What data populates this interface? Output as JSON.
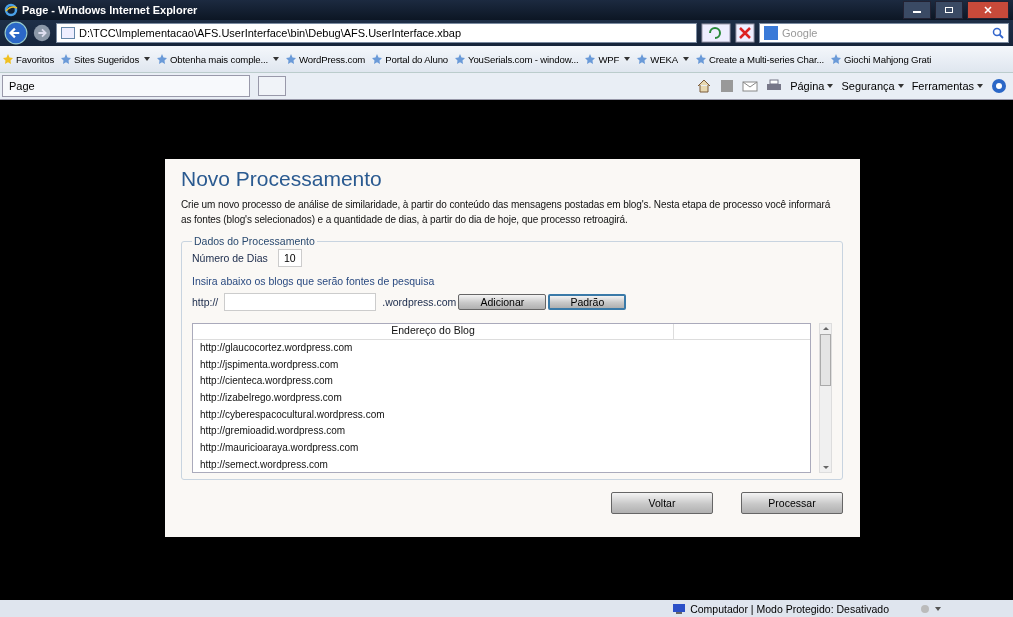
{
  "window": {
    "title": "Page - Windows Internet Explorer"
  },
  "address_bar": {
    "url": "D:\\TCC\\Implementacao\\AFS.UserInterface\\bin\\Debug\\AFS.UserInterface.xbap",
    "search_placeholder": "Google"
  },
  "favorites_bar": [
    {
      "label": "Favoritos",
      "dropdown": false
    },
    {
      "label": "Sites Sugeridos",
      "dropdown": true
    },
    {
      "label": "Obtenha mais comple...",
      "dropdown": true
    },
    {
      "label": "WordPress.com",
      "dropdown": false
    },
    {
      "label": "Portal do Aluno",
      "dropdown": false
    },
    {
      "label": "YouSerials.com - window...",
      "dropdown": false
    },
    {
      "label": "WPF",
      "dropdown": true
    },
    {
      "label": "WEKA",
      "dropdown": true
    },
    {
      "label": "Create a Multi-series Char...",
      "dropdown": false
    },
    {
      "label": "Giochi Mahjong Grati",
      "dropdown": false
    }
  ],
  "tab": {
    "label": "Page"
  },
  "command_bar": [
    "Página",
    "Segurança",
    "Ferramentas"
  ],
  "page": {
    "title": "Novo Processamento",
    "description": "Crie um novo processo de análise de similaridade, à partir do conteúdo das mensagens postadas em blog's. Nesta etapa de processo você informará as fontes (blog's selecionados) e a quantidade de dias, à partir do dia de hoje, que processo retroagirá.",
    "group_title": "Dados do Processamento",
    "days_label": "Número de Dias",
    "days_value": "10",
    "blogs_hint": "Insira abaixo os blogs que serão fontes de pesquisa",
    "prefix": "http://",
    "suffix": ".wordpress.com",
    "add_button": "Adicionar",
    "default_button": "Padrão",
    "table": {
      "columns": [
        "Endereço do Blog"
      ],
      "rows": [
        "http://glaucocortez.wordpress.com",
        "http://jspimenta.wordpress.com",
        "http://cienteca.wordpress.com",
        "http://izabelrego.wordpress.com",
        "http://cyberespacocultural.wordpress.com",
        "http://gremioadid.wordpress.com",
        "http://mauricioaraya.wordpress.com",
        "http://semect.wordpress.com"
      ]
    },
    "buttons": [
      "Voltar",
      "Processar"
    ]
  },
  "status_bar": {
    "text": "Computador | Modo Protegido: Desativado"
  }
}
